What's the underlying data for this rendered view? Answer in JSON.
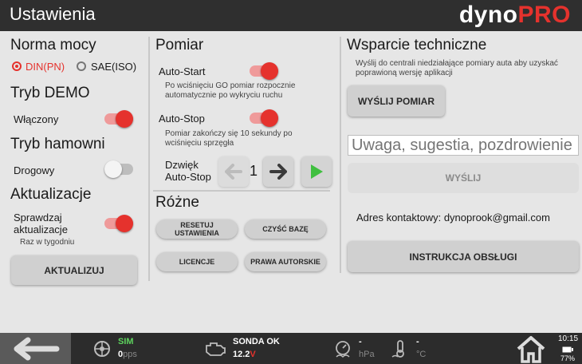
{
  "header": {
    "title": "Ustawienia",
    "logo_part1": "dyno",
    "logo_part2": "PRO"
  },
  "norma": {
    "heading": "Norma mocy",
    "option1": "DIN(PN)",
    "option2": "SAE(ISO)",
    "selected": "DIN(PN)"
  },
  "demo": {
    "heading": "Tryb DEMO",
    "label": "Włączony",
    "on": true
  },
  "hamowni": {
    "heading": "Tryb hamowni",
    "label": "Drogowy",
    "on": false
  },
  "aktualizacje": {
    "heading": "Aktualizacje",
    "label": "Sprawdzaj aktualizacje",
    "sub": "Raz w tygodniu",
    "on": true,
    "button": "AKTUALIZUJ"
  },
  "pomiar": {
    "heading": "Pomiar",
    "autostart_label": "Auto-Start",
    "autostart_desc": "Po wciśnięciu GO pomiar rozpocznie automatycznie po wykryciu ruchu",
    "autostop_label": "Auto-Stop",
    "autostop_desc": "Pomiar zakończy się 10 sekundy po wciśnięciu sprzęgła",
    "sound_label": "Dzwięk Auto-Stop",
    "sound_value": "1"
  },
  "rozne": {
    "heading": "Różne",
    "reset_button": "RESETUJ USTAWIENIA",
    "clear_button": "CZYŚĆ BAZĘ",
    "licenses_button": "LICENCJE",
    "copyright_button": "PRAWA AUTORSKIE"
  },
  "support": {
    "heading": "Wsparcie techniczne",
    "desc": "Wyślij do centrali niedziałające pomiary auta aby uzyskać poprawioną wersję aplikacji",
    "send_measure_button": "WYŚLIJ POMIAR",
    "feedback_placeholder": "Uwaga, sugestia, pozdrowienie",
    "send_button": "WYŚLIJ",
    "contact": "Adres kontaktowy: dynoprook@gmail.com",
    "manual_button": "INSTRUKCJA OBSŁUGI"
  },
  "status": {
    "sim_label": "SIM",
    "sim_value": "0",
    "sim_unit": "pps",
    "sonda_label": "SONDA OK",
    "sonda_value": "12.2",
    "sonda_unit": "V",
    "pressure_value": "-",
    "pressure_unit": "hPa",
    "temp_value": "-",
    "temp_unit": "°C",
    "time": "10:15",
    "battery": "77%"
  },
  "colors": {
    "accent": "#e5322d",
    "bar": "#2f2f2f",
    "green": "#5dd35d"
  }
}
